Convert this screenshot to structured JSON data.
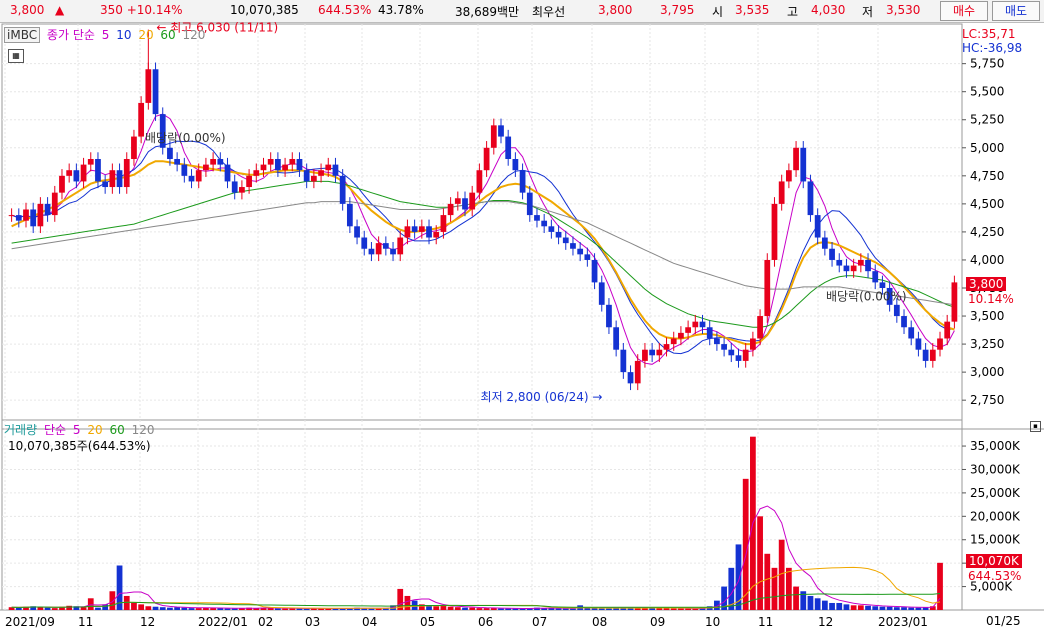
{
  "topbar": {
    "price": "3,800",
    "change": "350 +10.14%",
    "volume": "10,070,385",
    "volume_ratio": "644.53%",
    "turnover": "43.78%",
    "amount": "38,689백만",
    "bid_label": "최우선",
    "ask_price": "3,800",
    "bid_price": "3,795",
    "open_label": "시",
    "open": "3,535",
    "high_label": "고",
    "high": "4,030",
    "low_label": "저",
    "low": "3,530",
    "buy_button": "매수",
    "sell_button": "매도"
  },
  "price_panel": {
    "symbol_tab": "iMBC",
    "legend_prefix": "종가 단순",
    "ma_labels": [
      "5",
      "10",
      "20",
      "60",
      "120"
    ],
    "lc_label": "LC:35,71",
    "hc_label": "HC:-36,98",
    "current_price_tag": "3,800",
    "current_pct_tag": "10.14%",
    "high_annotation": "최고 6,030 (11/11)",
    "low_annotation": "최저 2,800 (06/24)",
    "dividend_label_1": "배당락(0.00%)",
    "dividend_label_2": "배당락(0.00%)"
  },
  "volume_panel": {
    "legend_prefix": "거래량",
    "legend_simple": "단순",
    "ma_labels": [
      "5",
      "20",
      "60",
      "120"
    ],
    "info": "10,070,385주(644.53%)",
    "current_volume_tag": "10,070K",
    "current_pct_tag": "644.53%"
  },
  "colors": {
    "up": "#e8001c",
    "down": "#1432d2",
    "ma5": "#c800c8",
    "ma10": "#1432d2",
    "ma20": "#f0a800",
    "ma60": "#1c9a1c",
    "ma120": "#888888",
    "grid": "#e6e6e6"
  },
  "chart_data": {
    "type": "candlestick",
    "x_ticks": [
      "2021/09",
      "11",
      "12",
      "2022/01",
      "02",
      "03",
      "04",
      "05",
      "06",
      "07",
      "08",
      "09",
      "10",
      "11",
      "12",
      "2023/01"
    ],
    "date_end_label": "01/25",
    "price_axis": {
      "ticks": [
        2750,
        3000,
        3250,
        3500,
        3750,
        4000,
        4250,
        4500,
        4750,
        5000,
        5250,
        5500,
        5750
      ],
      "tick_labels": [
        "2,750",
        "3,000",
        "3,250",
        "3,500",
        "3,750",
        "4,000",
        "4,250",
        "4,500",
        "4,750",
        "5,000",
        "5,250",
        "5,500",
        "5,750"
      ],
      "range": [
        2600,
        6050
      ]
    },
    "volume_axis": {
      "tick_labels": [
        "5,000K",
        "10,000K",
        "15,000K",
        "20,000K",
        "25,000K",
        "30,000K",
        "35,000K"
      ],
      "ticks": [
        5000,
        10000,
        15000,
        20000,
        25000,
        30000,
        35000
      ],
      "range": [
        0,
        38000
      ],
      "unit": "K"
    },
    "close_series": [
      4400,
      4350,
      4450,
      4300,
      4500,
      4400,
      4600,
      4750,
      4800,
      4700,
      4850,
      4900,
      4700,
      4650,
      4800,
      4650,
      4900,
      5100,
      5400,
      5700,
      5300,
      5000,
      4900,
      4850,
      4750,
      4700,
      4800,
      4850,
      4900,
      4850,
      4700,
      4600,
      4650,
      4750,
      4800,
      4850,
      4900,
      4800,
      4850,
      4900,
      4800,
      4700,
      4750,
      4800,
      4850,
      4750,
      4500,
      4300,
      4200,
      4100,
      4050,
      4150,
      4100,
      4050,
      4200,
      4300,
      4250,
      4300,
      4200,
      4250,
      4400,
      4500,
      4550,
      4450,
      4600,
      4800,
      5000,
      5200,
      5100,
      4900,
      4800,
      4600,
      4400,
      4350,
      4300,
      4250,
      4200,
      4150,
      4100,
      4050,
      4000,
      3800,
      3600,
      3400,
      3200,
      3000,
      2900,
      3100,
      3200,
      3150,
      3200,
      3250,
      3300,
      3350,
      3400,
      3450,
      3400,
      3300,
      3250,
      3200,
      3150,
      3100,
      3200,
      3300,
      3500,
      4000,
      4500,
      4700,
      4800,
      5000,
      4700,
      4400,
      4200,
      4100,
      4000,
      3950,
      3900,
      3950,
      4000,
      3900,
      3800,
      3750,
      3600,
      3500,
      3400,
      3300,
      3200,
      3100,
      3200,
      3300,
      3450,
      3800
    ],
    "ma20_series": [
      4300,
      4330,
      4360,
      4390,
      4420,
      4450,
      4480,
      4520,
      4560,
      4600,
      4640,
      4680,
      4700,
      4710,
      4720,
      4730,
      4740,
      4760,
      4800,
      4850,
      4880,
      4880,
      4870,
      4860,
      4850,
      4840,
      4830,
      4820,
      4810,
      4800,
      4790,
      4780,
      4770,
      4760,
      4760,
      4770,
      4780,
      4790,
      4800,
      4800,
      4800,
      4790,
      4780,
      4770,
      4760,
      4740,
      4700,
      4640,
      4570,
      4500,
      4440,
      4390,
      4340,
      4300,
      4270,
      4250,
      4250,
      4260,
      4270,
      4280,
      4300,
      4330,
      4370,
      4410,
      4460,
      4520,
      4570,
      4610,
      4650,
      4670,
      4680,
      4670,
      4640,
      4600,
      4560,
      4520,
      4470,
      4420,
      4370,
      4320,
      4260,
      4190,
      4100,
      4000,
      3890,
      3770,
      3650,
      3550,
      3460,
      3390,
      3340,
      3310,
      3300,
      3300,
      3310,
      3330,
      3340,
      3340,
      3330,
      3310,
      3290,
      3270,
      3250,
      3250,
      3270,
      3330,
      3430,
      3560,
      3710,
      3880,
      4020,
      4110,
      4150,
      4160,
      4150,
      4130,
      4100,
      4070,
      4040,
      4010,
      3980,
      3940,
      3890,
      3830,
      3760,
      3690,
      3620,
      3550,
      3490,
      3440,
      3400,
      3380
    ],
    "ma60_series": [
      4150,
      4160,
      4170,
      4180,
      4190,
      4200,
      4210,
      4220,
      4230,
      4240,
      4250,
      4260,
      4270,
      4280,
      4290,
      4300,
      4310,
      4320,
      4340,
      4360,
      4380,
      4400,
      4420,
      4440,
      4460,
      4480,
      4500,
      4520,
      4540,
      4560,
      4580,
      4600,
      4610,
      4620,
      4630,
      4640,
      4650,
      4660,
      4670,
      4680,
      4690,
      4700,
      4700,
      4700,
      4700,
      4690,
      4680,
      4660,
      4640,
      4620,
      4600,
      4580,
      4560,
      4540,
      4520,
      4510,
      4500,
      4490,
      4480,
      4470,
      4470,
      4470,
      4480,
      4490,
      4500,
      4510,
      4520,
      4530,
      4530,
      4530,
      4520,
      4510,
      4490,
      4460,
      4430,
      4400,
      4360,
      4320,
      4280,
      4240,
      4200,
      4150,
      4100,
      4040,
      3980,
      3920,
      3860,
      3800,
      3740,
      3690,
      3650,
      3610,
      3580,
      3550,
      3520,
      3500,
      3480,
      3460,
      3450,
      3440,
      3430,
      3420,
      3410,
      3400,
      3400,
      3410,
      3440,
      3480,
      3530,
      3590,
      3650,
      3710,
      3760,
      3800,
      3830,
      3850,
      3860,
      3860,
      3850,
      3840,
      3830,
      3820,
      3800,
      3780,
      3760,
      3740,
      3720,
      3690,
      3660,
      3630,
      3600,
      3580
    ],
    "ma120_series": [
      4100,
      4110,
      4120,
      4130,
      4140,
      4150,
      4160,
      4170,
      4180,
      4190,
      4200,
      4210,
      4220,
      4230,
      4240,
      4250,
      4260,
      4270,
      4280,
      4290,
      4300,
      4310,
      4320,
      4330,
      4340,
      4350,
      4360,
      4370,
      4380,
      4390,
      4400,
      4410,
      4420,
      4430,
      4440,
      4450,
      4460,
      4470,
      4480,
      4490,
      4500,
      4510,
      4510,
      4520,
      4520,
      4520,
      4520,
      4520,
      4510,
      4500,
      4490,
      4480,
      4470,
      4460,
      4450,
      4450,
      4450,
      4450,
      4450,
      4450,
      4460,
      4470,
      4480,
      4490,
      4500,
      4510,
      4520,
      4520,
      4520,
      4520,
      4510,
      4500,
      4490,
      4470,
      4450,
      4430,
      4410,
      4390,
      4370,
      4350,
      4330,
      4300,
      4270,
      4240,
      4210,
      4180,
      4150,
      4120,
      4090,
      4060,
      4030,
      4000,
      3970,
      3950,
      3930,
      3910,
      3890,
      3870,
      3850,
      3830,
      3810,
      3790,
      3770,
      3760,
      3750,
      3740,
      3740,
      3740,
      3740,
      3750,
      3760,
      3760,
      3760,
      3760,
      3760,
      3760,
      3750,
      3740,
      3730,
      3720,
      3710,
      3700,
      3690,
      3680,
      3670,
      3660,
      3650,
      3640,
      3630,
      3620,
      3610,
      3600
    ],
    "volume_series": [
      600,
      500,
      700,
      800,
      600,
      500,
      400,
      700,
      900,
      800,
      600,
      2500,
      500,
      1200,
      4000,
      9500,
      3000,
      1500,
      1200,
      800,
      700,
      600,
      500,
      600,
      500,
      400,
      400,
      500,
      400,
      400,
      300,
      300,
      400,
      500,
      400,
      500,
      400,
      300,
      300,
      400,
      300,
      300,
      400,
      300,
      300,
      300,
      300,
      400,
      500,
      400,
      300,
      300,
      400,
      1000,
      4500,
      3000,
      2000,
      1200,
      1000,
      800,
      900,
      700,
      600,
      500,
      500,
      400,
      400,
      400,
      300,
      300,
      300,
      300,
      400,
      500,
      400,
      400,
      300,
      300,
      300,
      1000,
      500,
      400,
      300,
      300,
      600,
      500,
      400,
      400,
      400,
      500,
      500,
      400,
      300,
      300,
      300,
      300,
      500,
      800,
      2000,
      5000,
      9000,
      14000,
      28000,
      37000,
      20000,
      12000,
      9000,
      15000,
      9000,
      5000,
      4000,
      3000,
      2500,
      2000,
      1500,
      1500,
      1200,
      1000,
      1000,
      900,
      800,
      700,
      700,
      600,
      600,
      500,
      500,
      600,
      800,
      10070
    ]
  }
}
